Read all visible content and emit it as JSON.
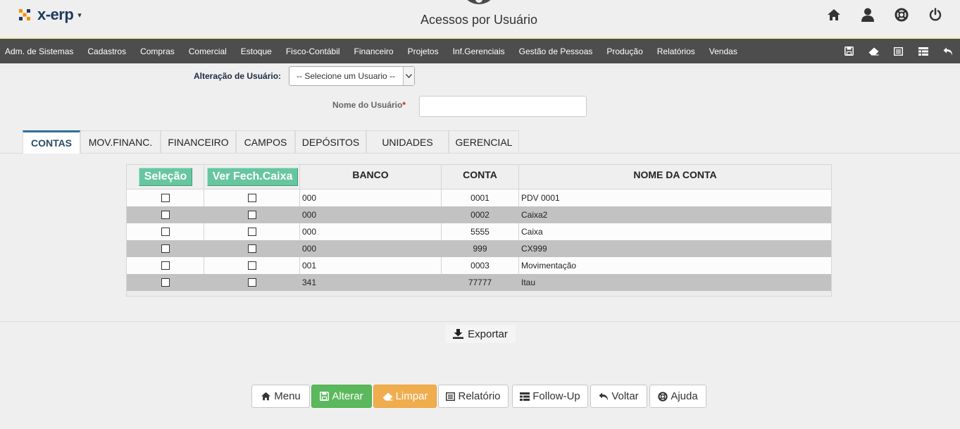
{
  "header": {
    "logo_text": "x-erp",
    "title": "Acessos por Usuário",
    "icons": [
      "home-icon",
      "user-icon",
      "lifebuoy-icon",
      "power-icon"
    ]
  },
  "nav": {
    "items": [
      "Adm. de Sistemas",
      "Cadastros",
      "Compras",
      "Comercial",
      "Estoque",
      "Fisco-Contábil",
      "Financeiro",
      "Projetos",
      "Inf.Gerenciais",
      "Gestão de Pessoas",
      "Produção",
      "Relatórios",
      "Vendas"
    ],
    "tools": [
      "save-icon",
      "eraser-icon",
      "list-icon",
      "table-icon",
      "undo-icon"
    ]
  },
  "form": {
    "user_change_label": "Alteração de Usuário:",
    "user_select_value": "-- Selecione um Usuario --",
    "user_name_label": "Nome do Usuário",
    "required_mark": "*",
    "user_name_value": ""
  },
  "tabs": [
    {
      "label": "CONTAS",
      "active": true
    },
    {
      "label": "MOV.FINANC.",
      "active": false
    },
    {
      "label": "FINANCEIRO",
      "active": false
    },
    {
      "label": "CAMPOS",
      "active": false
    },
    {
      "label": "DEPÓSITOS",
      "active": false
    },
    {
      "label": "UNIDADES",
      "active": false
    },
    {
      "label": "GERENCIAL",
      "active": false
    }
  ],
  "table": {
    "selection_button": "Seleção",
    "cash_button": "Ver Fech.Caixa",
    "headers": {
      "banco": "BANCO",
      "conta": "CONTA",
      "nome": "NOME DA CONTA"
    },
    "rows": [
      {
        "banco": "000",
        "conta": "0001",
        "nome": "PDV 0001",
        "sel": false,
        "caixa": false
      },
      {
        "banco": "000",
        "conta": "0002",
        "nome": "Caixa2",
        "sel": false,
        "caixa": false
      },
      {
        "banco": "000",
        "conta": "5555",
        "nome": "Caixa",
        "sel": false,
        "caixa": false
      },
      {
        "banco": "000",
        "conta": "999",
        "nome": "CX999",
        "sel": false,
        "caixa": false
      },
      {
        "banco": "001",
        "conta": "0003",
        "nome": "Movimentação",
        "sel": false,
        "caixa": false
      },
      {
        "banco": "341",
        "conta": "77777",
        "nome": "Itau",
        "sel": false,
        "caixa": false
      }
    ]
  },
  "export_label": "Exportar",
  "footer_buttons": [
    {
      "label": "Menu",
      "icon": "home-icon",
      "style": "default"
    },
    {
      "label": "Alterar",
      "icon": "save-icon",
      "style": "green"
    },
    {
      "label": "Limpar",
      "icon": "eraser-icon",
      "style": "orange"
    },
    {
      "label": "Relatório",
      "icon": "list-icon",
      "style": "default"
    },
    {
      "label": "Follow-Up",
      "icon": "table-icon",
      "style": "default"
    },
    {
      "label": "Voltar",
      "icon": "undo-icon",
      "style": "default"
    },
    {
      "label": "Ajuda",
      "icon": "lifebuoy-icon",
      "style": "default"
    }
  ]
}
